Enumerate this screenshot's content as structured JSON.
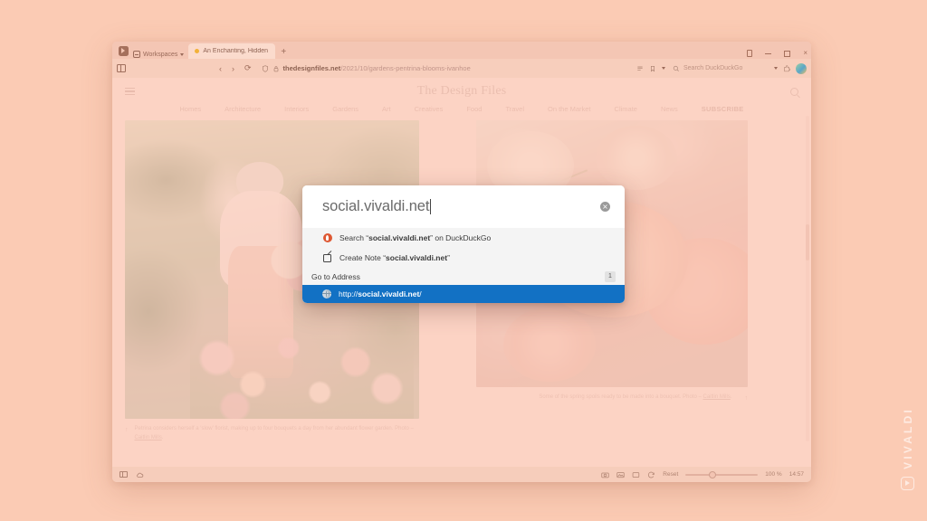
{
  "theme": {
    "desktop_bg": "#fbcbb4",
    "browser_chrome": "#f7cebc",
    "accent_selected": "#1271c4",
    "page_bg": "#fbddd2"
  },
  "watermark": {
    "label": "VIVALDI",
    "logo_icon": "vivaldi-logo-icon"
  },
  "tab_bar": {
    "app_icon": "vivaldi-logo-icon",
    "workspaces_label": "Workspaces",
    "workspaces_icon": "workspaces-icon",
    "tabs": [
      {
        "title": "An Enchanting, Hidden Flo",
        "favicon": "tab-favicon"
      }
    ],
    "new_tab_label": "+",
    "window_controls": {
      "trash": "trash-icon",
      "minimize": "minimize-icon",
      "maximize": "maximize-icon",
      "close": "×"
    }
  },
  "toolbar": {
    "panel_toggle_icon": "panel-toggle-icon",
    "back_label": "‹",
    "forward_label": "›",
    "reload_label": "⟳",
    "shield_icon": "shield-icon",
    "lock_icon": "lock-icon",
    "url_domain": "thedesignfiles.net",
    "url_path": "/2021/10/gardens-pentrina-blooms-ivanhoe",
    "reader_icon": "reader-view-icon",
    "bookmark_icon": "bookmark-icon",
    "dropdown_icon": "chevron-down-icon",
    "search_icon": "search-icon",
    "search_placeholder": "Search DuckDuckGo",
    "search_dropdown_icon": "chevron-down-icon",
    "extension_icon": "extension-icon",
    "avatar_icon": "profile-avatar"
  },
  "site": {
    "menu_icon": "hamburger-icon",
    "title": "The Design Files",
    "search_icon": "search-icon",
    "nav": [
      {
        "label": "Homes"
      },
      {
        "label": "Architecture"
      },
      {
        "label": "Interiors"
      },
      {
        "label": "Gardens"
      },
      {
        "label": "Art"
      },
      {
        "label": "Creatives"
      },
      {
        "label": "Food"
      },
      {
        "label": "Travel"
      },
      {
        "label": "On the Market"
      },
      {
        "label": "Climate"
      },
      {
        "label": "News"
      },
      {
        "label": "SUBSCRIBE"
      }
    ],
    "photos": [
      {
        "alt": "Woman in pink overalls holding a bouquet in a flower garden",
        "caption_arrow": "↑",
        "caption_text": "Petrina considers herself a ‘slow’ florist, making up to four bouquets a day from her abundant flower garden. Photo – ",
        "caption_credit": "Caitlin Mills",
        "caption_end": "."
      },
      {
        "alt": "Close-up of peach ranunculus blooms",
        "caption_arrow": "↑",
        "caption_text": "Some of the spring spoils ready to be made into a bouquet. Photo – ",
        "caption_credit": "Caitlin Mills",
        "caption_end": "."
      }
    ]
  },
  "url_popup": {
    "input_value": "social.vivaldi.net",
    "clear_button_label": "×",
    "clear_button_icon": "clear-input-icon",
    "suggestions": [
      {
        "icon": "duckduckgo-icon",
        "prefix": "Search “",
        "term": "social.vivaldi.net",
        "suffix": "” on DuckDuckGo"
      },
      {
        "icon": "create-note-icon",
        "prefix": "Create Note “",
        "term": "social.vivaldi.net",
        "suffix": "”"
      }
    ],
    "section_header": "Go to Address",
    "section_count": "1",
    "selected": {
      "icon": "globe-icon",
      "scheme": "http://",
      "host": "social.vivaldi.net",
      "path": "/"
    }
  },
  "status_bar": {
    "panel_icon": "panel-toggle-icon",
    "cloud_icon": "cloud-icon",
    "capture_icon": "capture-page-icon",
    "image_icon": "image-toggle-icon",
    "tiling_icon": "tile-tabs-icon",
    "animation_icon": "animation-toggle-icon",
    "reset_label": "Reset",
    "zoom_level": "100 %",
    "clock": "14:57"
  }
}
